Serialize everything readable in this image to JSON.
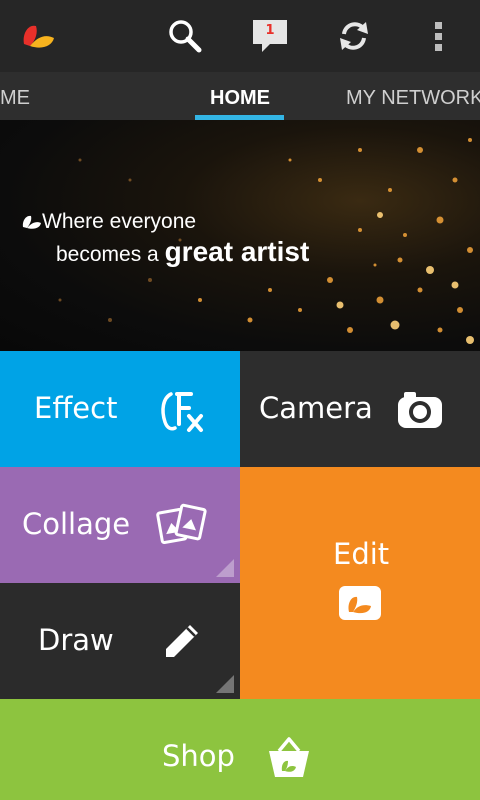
{
  "actionbar": {
    "app_logo": "picsart-logo",
    "search_icon": "search-icon",
    "notifications_icon": "chat-bubble-icon",
    "notifications_count": "1",
    "sync_icon": "refresh-icon",
    "overflow_icon": "more-vert-icon"
  },
  "tabs": [
    {
      "label": "ME"
    },
    {
      "label": "HOME",
      "active": true
    },
    {
      "label": "MY NETWORK"
    }
  ],
  "hero": {
    "line1": "Where everyone",
    "line2_prefix": "becomes a",
    "line2_emphasis": "great artist"
  },
  "tiles": {
    "effect": {
      "label": "Effect",
      "icon": "fx-icon",
      "color": "#00a3e6"
    },
    "camera": {
      "label": "Camera",
      "icon": "camera-icon",
      "color": "#2d2d2d"
    },
    "collage": {
      "label": "Collage",
      "icon": "collage-icon",
      "color": "#9a6ab3"
    },
    "edit": {
      "label": "Edit",
      "icon": "edit-photo-icon",
      "color": "#f48a1f"
    },
    "draw": {
      "label": "Draw",
      "icon": "pencil-icon",
      "color": "#2b2b2b"
    },
    "shop": {
      "label": "Shop",
      "icon": "shopping-basket-icon",
      "color": "#8dc43f"
    }
  },
  "colors": {
    "tab_indicator": "#33b5e5",
    "badge": "#e8302a"
  }
}
